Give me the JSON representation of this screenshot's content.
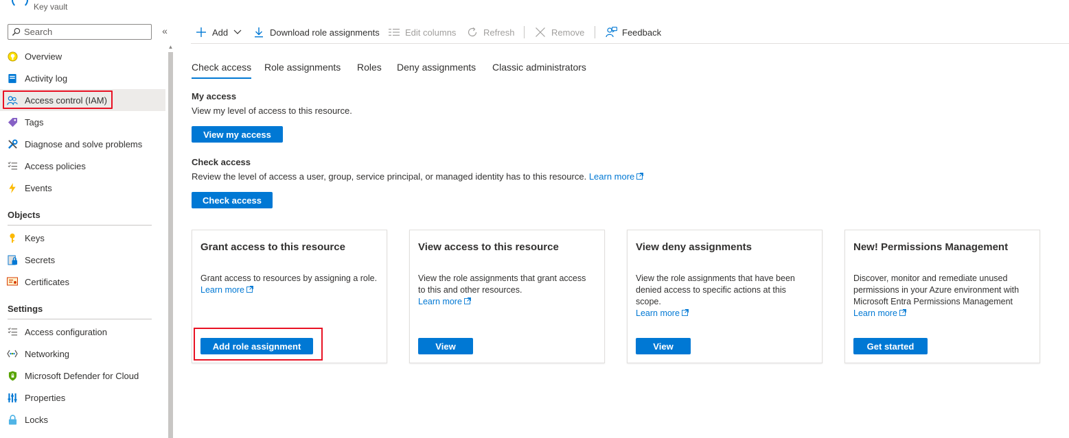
{
  "header": {
    "resource_type": "Key vault"
  },
  "sidebar": {
    "search_placeholder": "Search",
    "collapse_glyph": "«",
    "items": [
      {
        "label": "Overview"
      },
      {
        "label": "Activity log"
      },
      {
        "label": "Access control (IAM)"
      },
      {
        "label": "Tags"
      },
      {
        "label": "Diagnose and solve problems"
      },
      {
        "label": "Access policies"
      },
      {
        "label": "Events"
      }
    ],
    "objects_heading": "Objects",
    "objects": [
      {
        "label": "Keys"
      },
      {
        "label": "Secrets"
      },
      {
        "label": "Certificates"
      }
    ],
    "settings_heading": "Settings",
    "settings": [
      {
        "label": "Access configuration"
      },
      {
        "label": "Networking"
      },
      {
        "label": "Microsoft Defender for Cloud"
      },
      {
        "label": "Properties"
      },
      {
        "label": "Locks"
      }
    ]
  },
  "toolbar": {
    "add": "Add",
    "download": "Download role assignments",
    "edit_columns": "Edit columns",
    "refresh": "Refresh",
    "remove": "Remove",
    "feedback": "Feedback"
  },
  "tabs": [
    {
      "label": "Check access"
    },
    {
      "label": "Role assignments"
    },
    {
      "label": "Roles"
    },
    {
      "label": "Deny assignments"
    },
    {
      "label": "Classic administrators"
    }
  ],
  "my_access": {
    "title": "My access",
    "description": "View my level of access to this resource.",
    "button": "View my access"
  },
  "check_access": {
    "title": "Check access",
    "description": "Review the level of access a user, group, service principal, or managed identity has to this resource.",
    "link": "Learn more",
    "button": "Check access"
  },
  "cards": [
    {
      "title": "Grant access to this resource",
      "description": "Grant access to resources by assigning a role.",
      "link": "Learn more",
      "button": "Add role assignment"
    },
    {
      "title": "View access to this resource",
      "description": "View the role assignments that grant access to this and other resources.",
      "link": "Learn more",
      "button": "View"
    },
    {
      "title": "View deny assignments",
      "description": "View the role assignments that have been denied access to specific actions at this scope.",
      "link": "Learn more",
      "button": "View"
    },
    {
      "title": "New! Permissions Management",
      "description": "Discover, monitor and remediate unused permissions in your Azure environment with Microsoft Entra Permissions Management",
      "link": "Learn more",
      "button": "Get started"
    }
  ],
  "colors": {
    "accent": "#0078d4",
    "highlight_outline": "#e81123",
    "selected_bg": "#edebe9"
  }
}
